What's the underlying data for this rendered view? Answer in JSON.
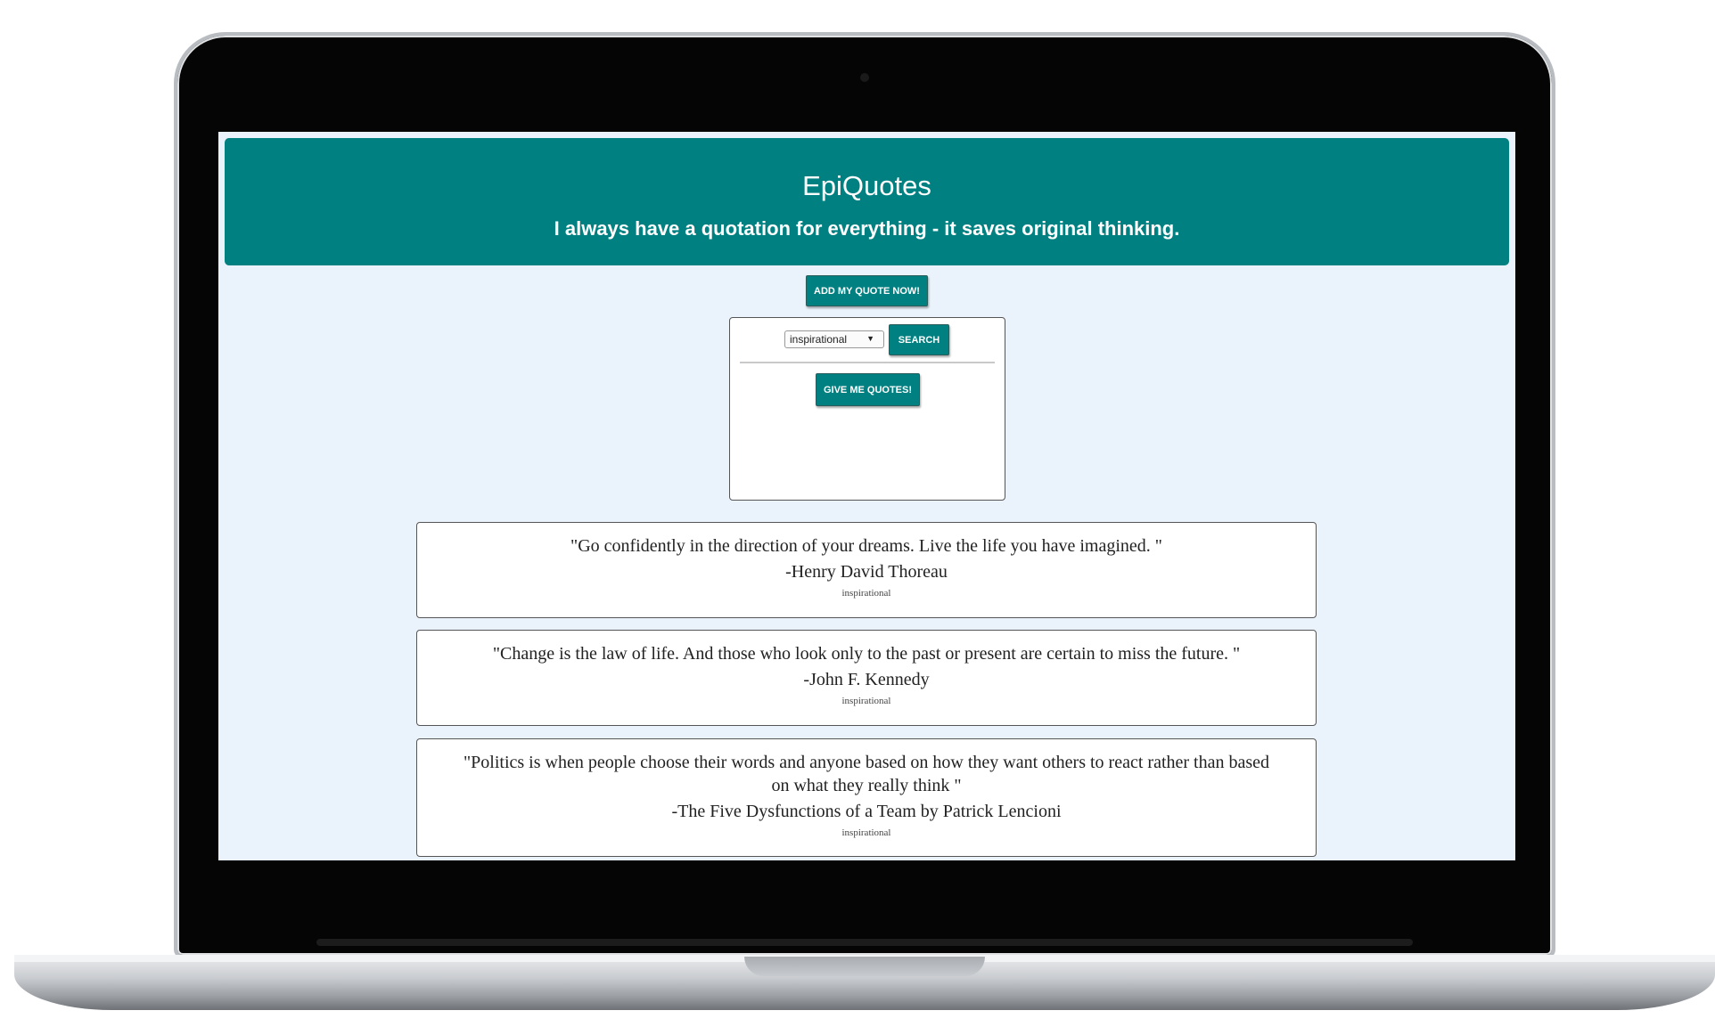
{
  "header": {
    "title": "EpiQuotes",
    "tagline": "I always have a quotation for everything - it saves original thinking."
  },
  "actions": {
    "add_quote_label": "ADD MY QUOTE NOW!"
  },
  "search": {
    "selected_category": "inspirational",
    "search_label": "SEARCH",
    "give_quotes_label": "GIVE ME QUOTES!"
  },
  "quotes": [
    {
      "text": "\"Go confidently in the direction of your dreams. Live the life you have imagined. \"",
      "author": "-Henry David Thoreau",
      "category": "inspirational"
    },
    {
      "text": "\"Change is the law of life. And those who look only to the past or present are certain to miss the future. \"",
      "author": "-John F. Kennedy",
      "category": "inspirational"
    },
    {
      "text": "\"Politics is when people choose their words and anyone based on how they want others to react rather than based on what they really think \"",
      "author": "-The Five Dysfunctions of a Team by Patrick Lencioni",
      "category": "inspirational"
    }
  ],
  "colors": {
    "brand": "#008080",
    "page_background": "#eaf2fb"
  }
}
